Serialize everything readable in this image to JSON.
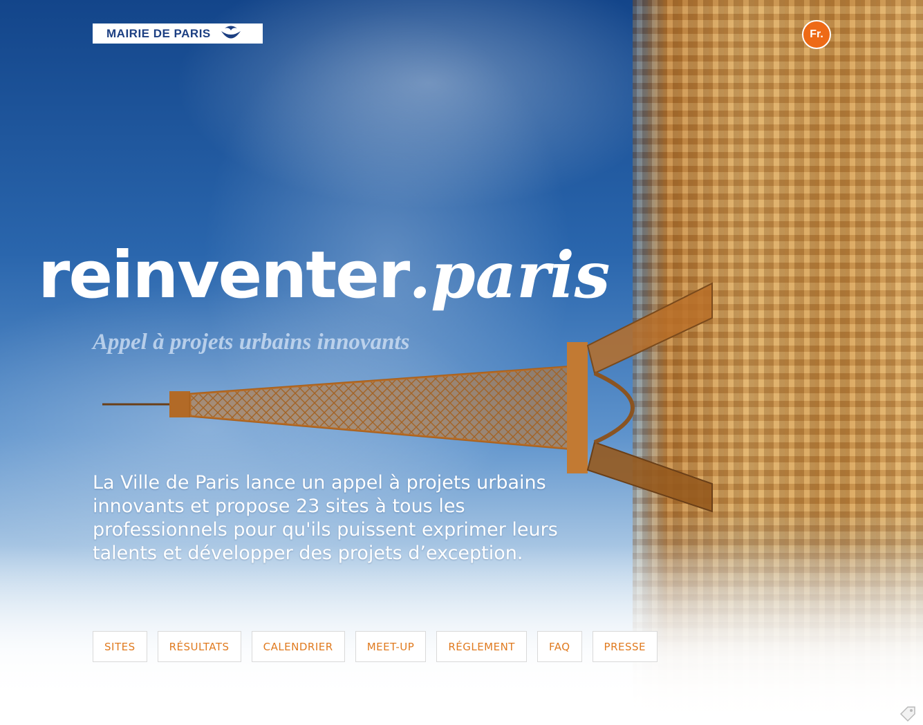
{
  "header": {
    "logo_text": "MAIRIE DE PARIS",
    "lang_label": "Fr."
  },
  "hero": {
    "title_main": "reinventer",
    "title_tld": ".paris",
    "subtitle": "Appel à projets urbains innovants",
    "intro": "La Ville de Paris lance un appel à projets urbains innovants et propose 23 sites à tous les professionnels pour qu'ils puissent exprimer leurs talents et développer des projets d’exception."
  },
  "nav": {
    "items": [
      {
        "label": "SITES"
      },
      {
        "label": "RÉSULTATS"
      },
      {
        "label": "CALENDRIER"
      },
      {
        "label": "MEET-UP"
      },
      {
        "label": "RÉGLEMENT"
      },
      {
        "label": "FAQ"
      },
      {
        "label": "PRESSE"
      }
    ]
  },
  "colors": {
    "accent_orange": "#ee6a16",
    "nav_text": "#e07a1f",
    "logo_blue": "#1c3f82"
  },
  "icons": {
    "logo_emblem": "paris-boat-emblem-icon",
    "corner": "tag-icon"
  }
}
